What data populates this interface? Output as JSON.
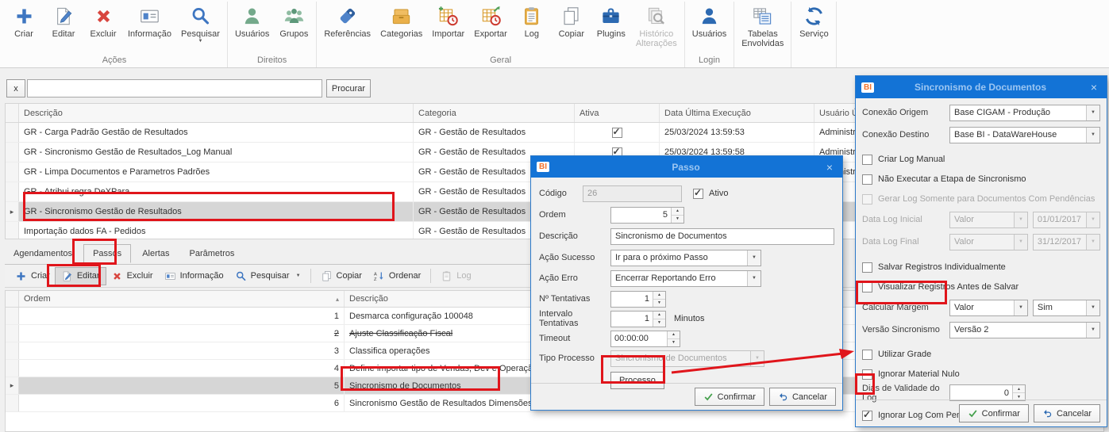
{
  "window": {
    "bg": "#f0f0f0",
    "accent_blue": "#1373d6",
    "annotation_red": "#e0151b"
  },
  "ribbon": {
    "groups": [
      {
        "label": "Ações",
        "items": [
          {
            "label": "Criar",
            "icon": "plus-icon"
          },
          {
            "label": "Editar",
            "icon": "edit-icon"
          },
          {
            "label": "Excluir",
            "icon": "delete-icon"
          },
          {
            "label": "Informação",
            "icon": "id-card-icon"
          },
          {
            "label": "Pesquisar",
            "icon": "search-icon",
            "dropdown": "▼"
          }
        ]
      },
      {
        "label": "Direitos",
        "items": [
          {
            "label": "Usuários",
            "icon": "user-green-icon"
          },
          {
            "label": "Grupos",
            "icon": "users-green-icon"
          }
        ]
      },
      {
        "label": "Geral",
        "items": [
          {
            "label": "Referências",
            "icon": "tag-icon"
          },
          {
            "label": "Categorias",
            "icon": "boxes-icon"
          },
          {
            "label": "Importar",
            "icon": "calendar-import-icon"
          },
          {
            "label": "Exportar",
            "icon": "calendar-export-icon"
          },
          {
            "label": "Log",
            "icon": "clipboard-icon"
          },
          {
            "label": "Copiar",
            "icon": "copy-icon"
          },
          {
            "label": "Plugins",
            "icon": "briefcase-icon"
          },
          {
            "label": "Histórico\nAlterações",
            "icon": "history-search-icon",
            "disabled": true
          }
        ]
      },
      {
        "label": "Login",
        "items": [
          {
            "label": "Usuários",
            "icon": "user-blue-icon"
          }
        ]
      },
      {
        "label": "",
        "items": [
          {
            "label": "Tabelas\nEnvolvidas",
            "icon": "tables-icon"
          }
        ]
      },
      {
        "label": "",
        "items": [
          {
            "label": "Serviço",
            "icon": "refresh-icon"
          }
        ]
      }
    ]
  },
  "search": {
    "clear": "x",
    "value": "",
    "button": "Procurar"
  },
  "table1": {
    "columns": [
      "Descrição",
      "Categoria",
      "Ativa",
      "Data Última Execução",
      "Usuário Últ"
    ],
    "rows": [
      {
        "descricao": "GR - Carga Padrão Gestão de Resultados",
        "categoria": "GR - Gestão de Resultados",
        "ativa": true,
        "data_ultima": "25/03/2024 13:59:53",
        "usuario": "Administrad"
      },
      {
        "descricao": "GR - Sincronismo Gestão de Resultados_Log Manual",
        "categoria": "GR - Gestão de Resultados",
        "ativa": true,
        "data_ultima": "25/03/2024 13:59:58",
        "usuario": "Administrad"
      },
      {
        "descricao": "GR - Limpa Documentos e Parametros Padrões",
        "categoria": "GR - Gestão de Resultados",
        "ativa": true,
        "data_ultima": "",
        "usuario": "Administrad"
      },
      {
        "descricao": "GR - Atribui regra DeXPara",
        "categoria": "GR - Gestão de Resultados",
        "ativa": false,
        "data_ultima": "",
        "usuario": ""
      },
      {
        "descricao": "GR - Sincronismo Gestão de Resultados",
        "categoria": "GR - Gestão de Resultados",
        "ativa": false,
        "data_ultima": "",
        "usuario": "",
        "selected": true
      },
      {
        "descricao": "Importação dados FA - Pedidos",
        "categoria": "GR - Gestão de Resultados",
        "ativa": false,
        "data_ultima": "",
        "usuario": ""
      }
    ],
    "row_marker": "▸"
  },
  "tabs": [
    "Agendamentos",
    "Passos",
    "Alertas",
    "Parâmetros"
  ],
  "toolbar2": {
    "criar": "Criar",
    "editar": "Editar",
    "excluir": "Excluir",
    "informacao": "Informação",
    "pesquisar": "Pesquisar",
    "copiar": "Copiar",
    "ordenar": "Ordenar",
    "log": "Log"
  },
  "table2": {
    "columns": [
      "Ordem",
      "Descrição"
    ],
    "sort_indicator": "▴",
    "rows": [
      {
        "ordem": "1",
        "descricao": "Desmarca configuração 100048"
      },
      {
        "ordem": "2",
        "descricao": "Ajuste Classificação Fiscal",
        "struck": true
      },
      {
        "ordem": "3",
        "descricao": "Classifica operações"
      },
      {
        "ordem": "4",
        "descricao": "Define importar tipo de Vendas, Dev e Operação"
      },
      {
        "ordem": "5",
        "descricao": "Sincronismo de Documentos",
        "selected": true
      },
      {
        "ordem": "6",
        "descricao": "Sincronismo Gestão de Resultados Dimensões"
      }
    ],
    "row_marker": "▸"
  },
  "dialog_passo": {
    "badge": "BI",
    "title": "Passo",
    "close": "×",
    "codigo_label": "Código",
    "codigo_value": "26",
    "ativo_label": "Ativo",
    "ativo_checked": true,
    "ordem_label": "Ordem",
    "ordem_value": "5",
    "descricao_label": "Descrição",
    "descricao_value": "Sincronismo de Documentos",
    "acao_sucesso_label": "Ação Sucesso",
    "acao_sucesso_value": "Ir para o próximo Passo",
    "acao_erro_label": "Ação Erro",
    "acao_erro_value": "Encerrar Reportando Erro",
    "tentativas_label": "Nº Tentativas",
    "tentativas_value": "1",
    "intervalo_label": "Intervalo Tentativas",
    "intervalo_value": "1",
    "intervalo_suffix": "Minutos",
    "timeout_label": "Timeout",
    "timeout_value": "00:00:00",
    "tipo_label": "Tipo Processo",
    "tipo_value": "Sincronismo de Documentos",
    "processo_button": "Processo",
    "confirmar": "Confirmar",
    "cancelar": "Cancelar"
  },
  "dialog_sync": {
    "badge": "BI",
    "title": "Sincronismo de Documentos",
    "close": "×",
    "conexao_origem_label": "Conexão Origem",
    "conexao_origem_value": "Base CIGAM - Produção",
    "conexao_destino_label": "Conexão Destino",
    "conexao_destino_value": "Base BI - DataWareHouse",
    "cb_criar_log": "Criar Log Manual",
    "cb_criar_log_checked": false,
    "cb_nao_executar": "Não Executar a Etapa de Sincronismo",
    "cb_nao_executar_checked": false,
    "cb_gerar_log": "Gerar Log Somente para Documentos Com Pendências",
    "cb_gerar_log_checked": false,
    "data_inicial_label": "Data Log Inicial",
    "data_inicial_modo": "Valor",
    "data_inicial_value": "01/01/2017",
    "data_final_label": "Data Log Final",
    "data_final_modo": "Valor",
    "data_final_value": "31/12/2017",
    "cb_salvar": "Salvar Registros Individualmente",
    "cb_salvar_checked": false,
    "cb_visualizar": "Visualizar Registros Antes de Salvar",
    "cb_visualizar_checked": false,
    "calcular_margem_label": "Calcular Margem",
    "calcular_margem_modo": "Valor",
    "calcular_margem_value": "Sim",
    "versao_label": "Versão Sincronismo",
    "versao_value": "Versão 2",
    "cb_grade": "Utilizar Grade",
    "cb_grade_checked": false,
    "cb_material": "Ignorar Material Nulo",
    "cb_material_checked": false,
    "dias_label": "Dias de Validade do Log",
    "dias_value": "0",
    "cb_pendencias": "Ignorar Log Com Pendências",
    "cb_pendencias_checked": true,
    "confirmar": "Confirmar",
    "cancelar": "Cancelar"
  }
}
